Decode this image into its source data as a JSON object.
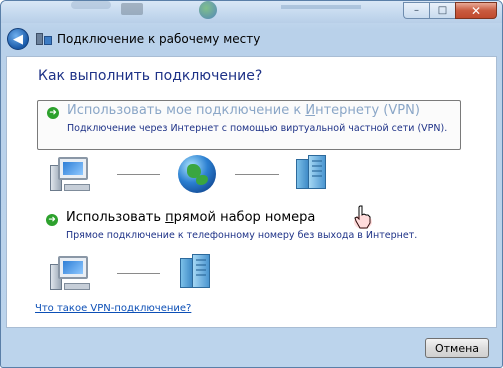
{
  "window": {
    "title": "Подключение к рабочему месту",
    "controls": {
      "minimize": "–",
      "maximize": "□",
      "close": "✕"
    }
  },
  "nav": {
    "back_icon": "back-arrow-icon"
  },
  "page": {
    "heading": "Как выполнить подключение?"
  },
  "options": [
    {
      "title_before": "Использовать мое подключение к ",
      "title_underlined": "И",
      "title_after": "нтернету (VPN)",
      "description": "Подключение через Интернет с помощью виртуальной частной сети (VPN).",
      "selected": true
    },
    {
      "title_before": "Использовать ",
      "title_underlined": "п",
      "title_after": "рямой набор номера",
      "description": "Прямое подключение к телефонному номеру без выхода в Интернет.",
      "selected": false
    }
  ],
  "help": {
    "link": "Что такое VPN-подключение?"
  },
  "footer": {
    "cancel_label": "Отмена"
  },
  "colors": {
    "heading": "#1e3287",
    "link": "#0c4fb6",
    "arrow": "#2da12d",
    "frame": "#bcd4ec"
  }
}
